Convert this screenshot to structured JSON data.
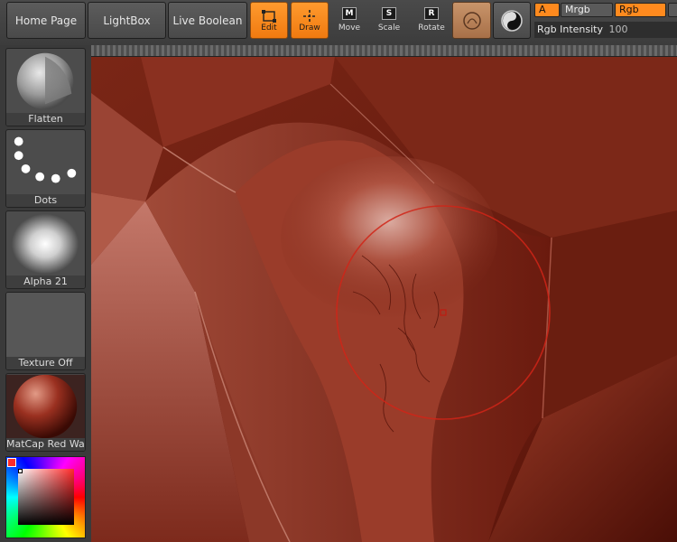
{
  "toolbar": {
    "home_page": "Home Page",
    "lightbox": "LightBox",
    "live_boolean": "Live Boolean",
    "edit": "Edit",
    "draw": "Draw",
    "move": {
      "label": "Move",
      "key": "M"
    },
    "scale": {
      "label": "Scale",
      "key": "S"
    },
    "rotate": {
      "label": "Rotate",
      "key": "R"
    },
    "channel_a": "A",
    "mrgb": "Mrgb",
    "rgb": "Rgb",
    "rgb_intensity_label": "Rgb Intensity",
    "rgb_intensity_value": "100"
  },
  "shelf": {
    "brush": "Flatten",
    "stroke": "Dots",
    "alpha": "Alpha 21",
    "texture": "Texture Off",
    "material": "MatCap Red Wax"
  },
  "colors": {
    "active_orange": "#ff8a1e",
    "panel_grey": "#4c4c4c",
    "model_red": "#8a2a1a",
    "brush_ring": "#d02418"
  },
  "icons": [
    "edit-icon",
    "draw-icon",
    "move-icon",
    "scale-icon",
    "rotate-icon",
    "material-sphere-icon",
    "symmetry-icon"
  ]
}
